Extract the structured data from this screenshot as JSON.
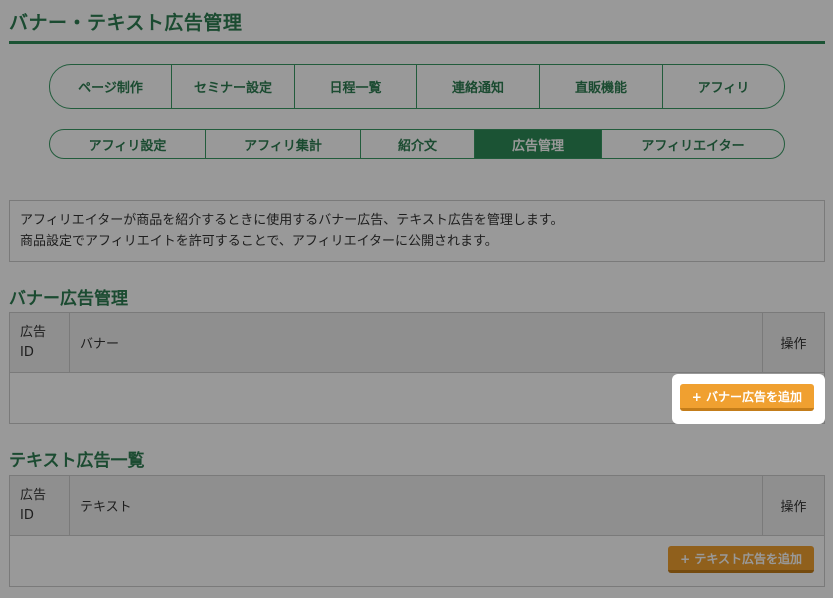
{
  "page_title": "バナー・テキスト広告管理",
  "nav_primary": [
    {
      "label": "ページ制作",
      "active": false
    },
    {
      "label": "セミナー設定",
      "active": false
    },
    {
      "label": "日程一覧",
      "active": false
    },
    {
      "label": "連絡通知",
      "active": false
    },
    {
      "label": "直販機能",
      "active": false
    },
    {
      "label": "アフィリ",
      "active": false
    }
  ],
  "nav_secondary": [
    {
      "label": "アフィリ設定",
      "active": false
    },
    {
      "label": "アフィリ集計",
      "active": false
    },
    {
      "label": "紹介文",
      "active": false
    },
    {
      "label": "広告管理",
      "active": true
    },
    {
      "label": "アフィリエイター",
      "active": false
    }
  ],
  "description": {
    "line1": "アフィリエイターが商品を紹介するときに使用するバナー広告、テキスト広告を管理します。",
    "line2": "商品設定でアフィリエイトを許可することで、アフィリエイターに公開されます。"
  },
  "banner_section": {
    "title": "バナー広告管理",
    "col_id": "広告ID",
    "col_id_line1": "広告",
    "col_id_line2": "ID",
    "col_main": "バナー",
    "col_op": "操作",
    "add_button": "+ バナー広告を追加"
  },
  "text_section": {
    "title": "テキスト広告一覧",
    "col_id": "広告ID",
    "col_id_line1": "広告",
    "col_id_line2": "ID",
    "col_main": "テキスト",
    "col_op": "操作",
    "add_button": "+ テキスト広告を追加"
  },
  "colors": {
    "brand_green": "#2e8b57",
    "button_orange": "#f0a030"
  }
}
